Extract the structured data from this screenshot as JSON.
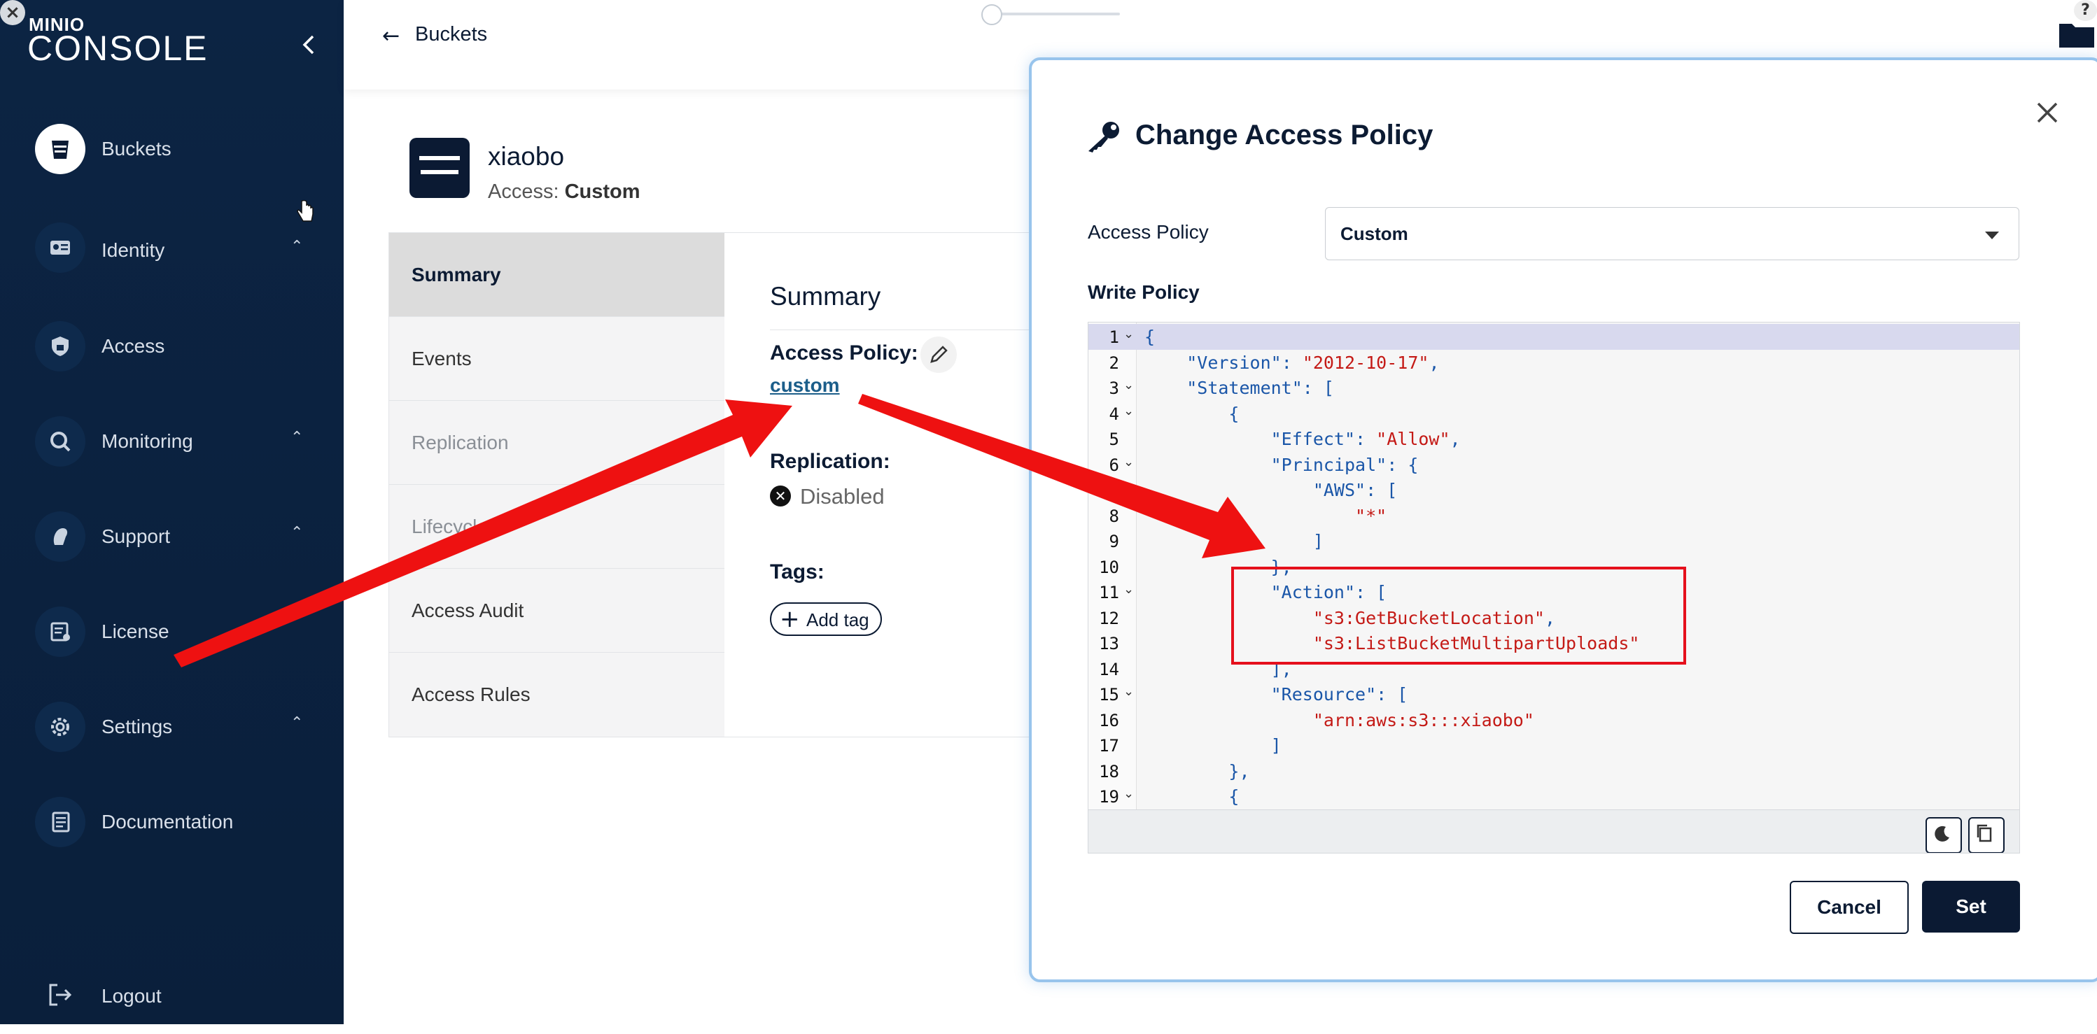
{
  "sidebar": {
    "logo_top": "MINIO",
    "logo_main": "CONSOLE",
    "items": [
      {
        "label": "Buckets",
        "icon": "bucket-icon",
        "has_chevron": false,
        "active": true
      },
      {
        "label": "Identity",
        "icon": "identity-icon",
        "has_chevron": true
      },
      {
        "label": "Access",
        "icon": "lock-icon",
        "has_chevron": false
      },
      {
        "label": "Monitoring",
        "icon": "monitoring-icon",
        "has_chevron": true
      },
      {
        "label": "Support",
        "icon": "support-icon",
        "has_chevron": true
      },
      {
        "label": "License",
        "icon": "license-icon",
        "has_chevron": false
      },
      {
        "label": "Settings",
        "icon": "gear-icon",
        "has_chevron": true
      },
      {
        "label": "Documentation",
        "icon": "document-icon",
        "has_chevron": false
      }
    ],
    "logout_label": "Logout"
  },
  "header": {
    "back_label": "Buckets"
  },
  "bucket": {
    "name": "xiaobo",
    "access_prefix": "Access:",
    "access_value": "Custom"
  },
  "tabs": [
    {
      "label": "Summary",
      "state": "active"
    },
    {
      "label": "Events",
      "state": "normal"
    },
    {
      "label": "Replication",
      "state": "disabled"
    },
    {
      "label": "Lifecycle",
      "state": "disabled"
    },
    {
      "label": "Access Audit",
      "state": "normal"
    },
    {
      "label": "Access Rules",
      "state": "normal"
    }
  ],
  "summary": {
    "title": "Summary",
    "access_policy_label": "Access Policy:",
    "access_policy_value": "custom",
    "replication_label": "Replication:",
    "replication_value": "Disabled",
    "tags_label": "Tags:",
    "add_tag_label": "Add tag"
  },
  "modal": {
    "title": "Change Access Policy",
    "access_policy_label": "Access Policy",
    "access_policy_selected": "Custom",
    "write_policy_label": "Write Policy",
    "cancel_label": "Cancel",
    "set_label": "Set"
  },
  "code_lines": [
    {
      "n": "1",
      "fold": true,
      "text": "{"
    },
    {
      "n": "2",
      "fold": false,
      "text": "    \"Version\": \"2012-10-17\","
    },
    {
      "n": "3",
      "fold": true,
      "text": "    \"Statement\": ["
    },
    {
      "n": "4",
      "fold": true,
      "text": "        {"
    },
    {
      "n": "5",
      "fold": false,
      "text": "            \"Effect\": \"Allow\","
    },
    {
      "n": "6",
      "fold": true,
      "text": "            \"Principal\": {"
    },
    {
      "n": "7",
      "fold": false,
      "text": "                \"AWS\": ["
    },
    {
      "n": "8",
      "fold": false,
      "text": "                    \"*\""
    },
    {
      "n": "9",
      "fold": false,
      "text": "                ]"
    },
    {
      "n": "10",
      "fold": false,
      "text": "            },"
    },
    {
      "n": "11",
      "fold": true,
      "text": "            \"Action\": ["
    },
    {
      "n": "12",
      "fold": false,
      "text": "                \"s3:GetBucketLocation\","
    },
    {
      "n": "13",
      "fold": false,
      "text": "                \"s3:ListBucketMultipartUploads\""
    },
    {
      "n": "14",
      "fold": false,
      "text": "            ],"
    },
    {
      "n": "15",
      "fold": true,
      "text": "            \"Resource\": ["
    },
    {
      "n": "16",
      "fold": false,
      "text": "                \"arn:aws:s3:::xiaobo\""
    },
    {
      "n": "17",
      "fold": false,
      "text": "            ]"
    },
    {
      "n": "18",
      "fold": false,
      "text": "        },"
    },
    {
      "n": "19",
      "fold": true,
      "text": "        {"
    }
  ],
  "colors": {
    "sidebar_bg": "#0c2443",
    "primary": "#0b1a33",
    "link": "#1c5e8a",
    "annotation_red": "#e5101c",
    "json_key": "#1a56a8",
    "json_string": "#c41a16"
  }
}
